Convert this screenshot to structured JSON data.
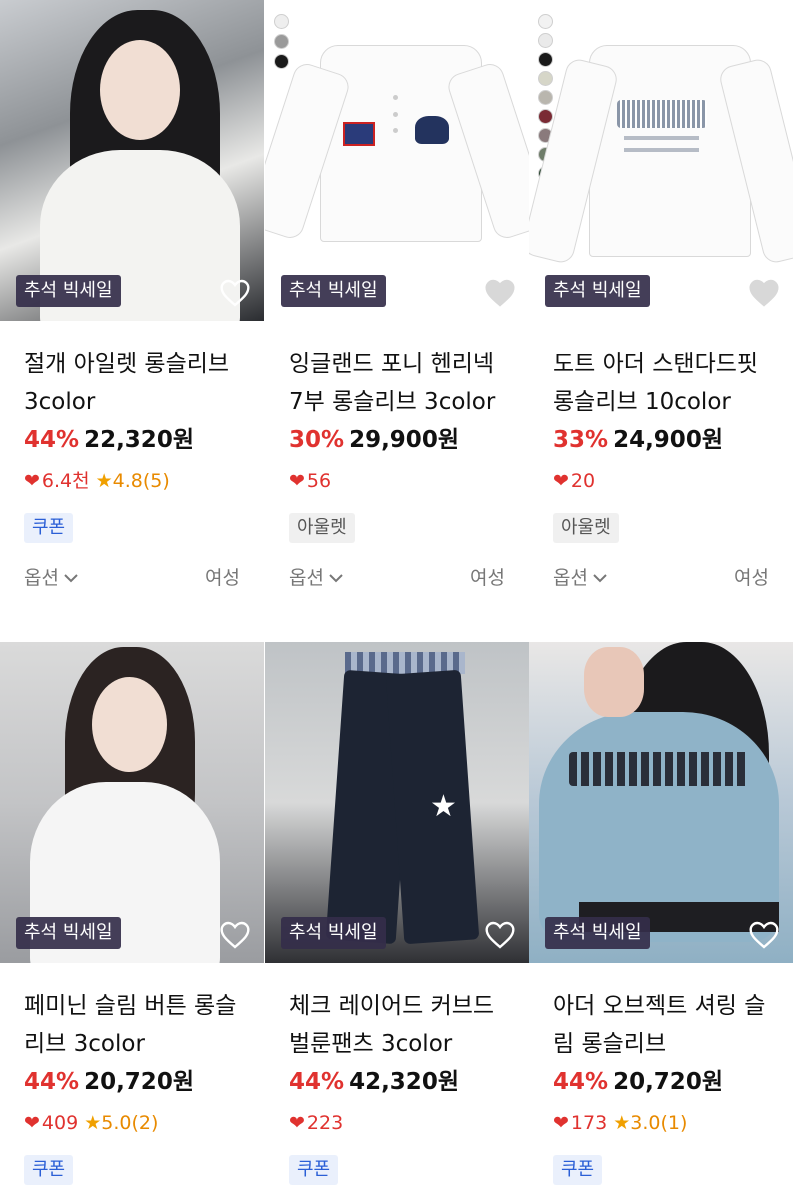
{
  "products": [
    {
      "badge": "추석 빅세일",
      "title": "절개 아일렛 롱슬리브 3color",
      "discount": "44%",
      "price": "22,320원",
      "likes": "6.4천",
      "rating": "4.8(5)",
      "tag": "쿠폰",
      "tag_type": "coupon",
      "option": "옵션",
      "gender": "여성"
    },
    {
      "badge": "추석 빅세일",
      "title": "잉글랜드 포니 헨리넥 7부 롱슬리브 3color",
      "discount": "30%",
      "price": "29,900원",
      "likes": "56",
      "rating": "",
      "tag": "아울렛",
      "tag_type": "outlet",
      "option": "옵션",
      "gender": "여성"
    },
    {
      "badge": "추석 빅세일",
      "title": "도트 아더 스탠다드핏 롱슬리브 10color",
      "discount": "33%",
      "price": "24,900원",
      "likes": "20",
      "rating": "",
      "tag": "아울렛",
      "tag_type": "outlet",
      "option": "옵션",
      "gender": "여성"
    },
    {
      "badge": "추석 빅세일",
      "title": "페미닌 슬림 버튼 롱슬리브 3color",
      "discount": "44%",
      "price": "20,720원",
      "likes": "409",
      "rating": "5.0(2)",
      "tag": "쿠폰",
      "tag_type": "coupon"
    },
    {
      "badge": "추석 빅세일",
      "title": "체크 레이어드 커브드 벌룬팬츠 3color",
      "discount": "44%",
      "price": "42,320원",
      "likes": "223",
      "rating": "",
      "tag": "쿠폰",
      "tag_type": "coupon"
    },
    {
      "badge": "추석 빅세일",
      "title": "아더 오브젝트 셔링 슬림 롱슬리브",
      "discount": "44%",
      "price": "20,720원",
      "likes": "173",
      "rating": "3.0(1)",
      "tag": "쿠폰",
      "tag_type": "coupon"
    }
  ],
  "swatch_colors": {
    "p2": [
      "#eeeeee",
      "#9a9a9a",
      "#1a1a1a"
    ],
    "p3": [
      "#f2f2f2",
      "#eaeaea",
      "#1a1a1a",
      "#d6d6c8",
      "#b9b6ae",
      "#7a2a34",
      "#8a7a7c",
      "#6f7d6a",
      "#2f4a36",
      "#f2dde0",
      "#ececec"
    ]
  },
  "colors": {
    "discount": "#e0322f",
    "heart": "#e0322f",
    "star": "#f0a000",
    "coupon": "#2b5fd6",
    "badge_bg": "#342e4a"
  }
}
